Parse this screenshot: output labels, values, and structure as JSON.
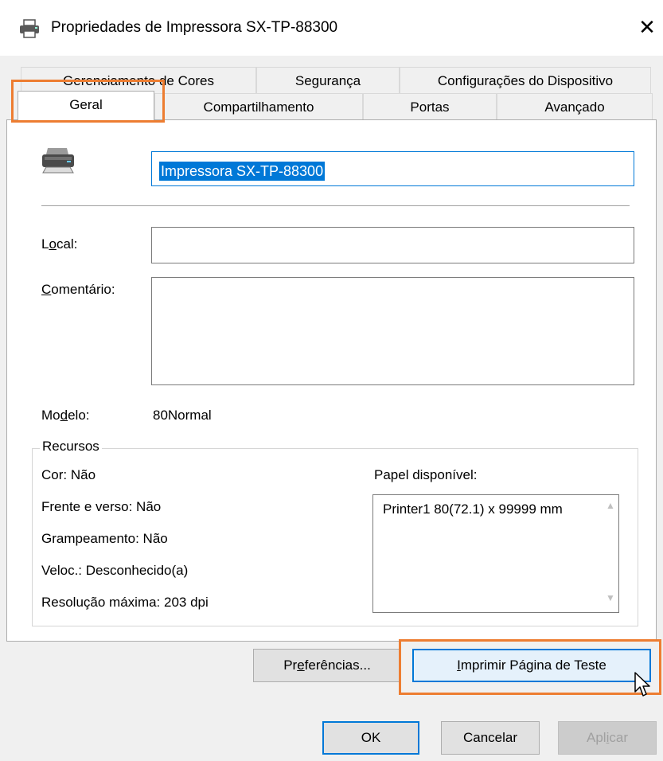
{
  "window": {
    "title": "Propriedades de Impressora SX-TP-88300",
    "close_glyph": "✕"
  },
  "tabs_row1": [
    {
      "label": "Gerenciamento de Cores"
    },
    {
      "label": "Segurança"
    },
    {
      "label": "Configurações do Dispositivo"
    }
  ],
  "tabs_row2": [
    {
      "label": "Geral",
      "active": true
    },
    {
      "label": "Compartilhamento"
    },
    {
      "label": "Portas"
    },
    {
      "label": "Avançado"
    }
  ],
  "general": {
    "printer_name": "Impressora SX-TP-88300",
    "location_label": {
      "pre": "L",
      "key": "o",
      "post": "cal:"
    },
    "location_value": "",
    "comment_label": {
      "pre": "",
      "key": "C",
      "post": "omentário:"
    },
    "comment_value": "",
    "model_label": {
      "pre": "Mo",
      "key": "d",
      "post": "elo:"
    },
    "model_value": "80Normal"
  },
  "features": {
    "group_title": "Recursos",
    "color": "Cor: Não",
    "duplex": "Frente e verso: Não",
    "staple": "Grampeamento: Não",
    "speed": "Veloc.: Desconhecido(a)",
    "max_resolution": "Resolução máxima: 203 dpi",
    "paper_label": "Papel disponível:",
    "paper_items": [
      "Printer1 80(72.1) x 99999 mm"
    ]
  },
  "buttons": {
    "preferences": {
      "pre": "Pr",
      "key": "e",
      "post": "ferências..."
    },
    "print_test": {
      "pre": "",
      "key": "I",
      "post": "mprimir Página de Teste"
    },
    "ok": "OK",
    "cancel": "Cancelar",
    "apply": {
      "pre": "Apl",
      "key": "i",
      "post": "car"
    }
  },
  "colors": {
    "accent": "#0078d7",
    "highlight": "#ed7d31"
  },
  "icons": {
    "title": "printer-icon",
    "panel": "printer-icon",
    "cursor": "arrow-cursor-icon"
  }
}
